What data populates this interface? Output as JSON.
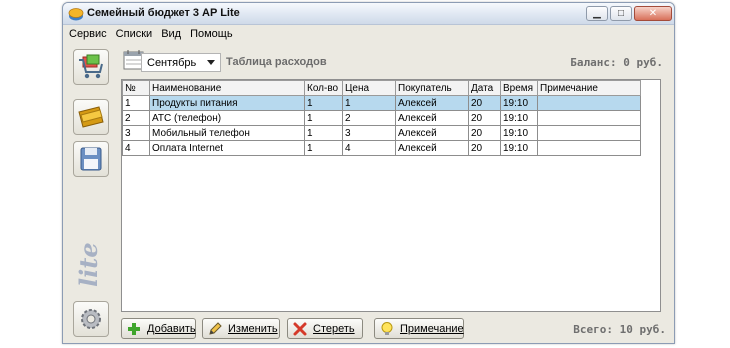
{
  "window": {
    "title": "Семейный бюджет 3 AP Lite",
    "controls": {
      "minimize": "▁",
      "maximize": "□",
      "close": "✕"
    }
  },
  "menu": [
    "Сервис",
    "Списки",
    "Вид",
    "Помощь"
  ],
  "sidebar": {
    "buttons": [
      {
        "name": "shopping-cart-icon"
      },
      {
        "name": "wallet-icon"
      },
      {
        "name": "floppy-save-icon"
      }
    ],
    "logo": "lite",
    "settings": {
      "name": "gear-icon"
    }
  },
  "header": {
    "month": "Сентябрь",
    "table_title": "Таблица расходов",
    "balance": "Баланс: 0 руб."
  },
  "table": {
    "columns": [
      "№",
      "Наименование",
      "Кол-во",
      "Цена",
      "Покупатель",
      "Дата",
      "Время",
      "Примечание"
    ],
    "rows": [
      [
        "1",
        "Продукты питания",
        "1",
        "1",
        "Алексей",
        "20",
        "19:10",
        ""
      ],
      [
        "2",
        "АТС (телефон)",
        "1",
        "2",
        "Алексей",
        "20",
        "19:10",
        ""
      ],
      [
        "3",
        "Мобильный телефон",
        "1",
        "3",
        "Алексей",
        "20",
        "19:10",
        ""
      ],
      [
        "4",
        "Оплата Internet",
        "1",
        "4",
        "Алексей",
        "20",
        "19:10",
        ""
      ]
    ],
    "selected_row": 0
  },
  "actions": {
    "add": "Добавить",
    "edit": "Изменить",
    "delete": "Стереть",
    "note": "Примечание"
  },
  "total": "Всего: 10 руб.",
  "colors": {
    "selection": "#b7d9ee",
    "window_bg": "#ebe9e1",
    "header_muted": "#6f6f6f"
  }
}
